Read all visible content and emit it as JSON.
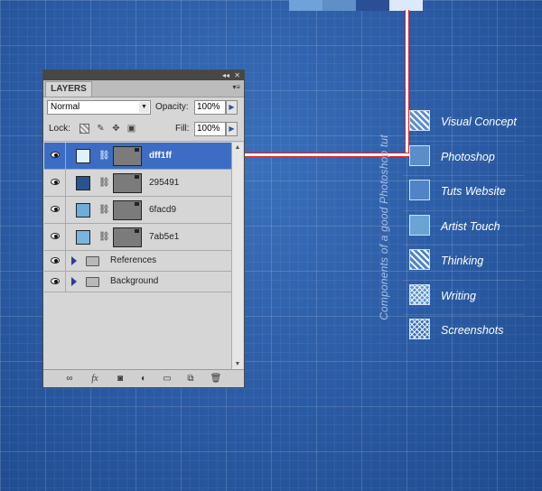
{
  "top_swatches": [
    "#6fa2d8",
    "#5e90c7",
    "#2a4f96",
    "#dbe9fb"
  ],
  "caption": "Components of a good Photoshop tut",
  "legend": [
    {
      "label": "Visual Concept",
      "style": "diag",
      "color": "#5c8dcb"
    },
    {
      "label": "Photoshop",
      "style": "solid",
      "color": "#5c8dcb"
    },
    {
      "label": "Tuts Website",
      "style": "solid",
      "color": "#4f84c6"
    },
    {
      "label": "Artist Touch",
      "style": "solid",
      "color": "#6aa4d6"
    },
    {
      "label": "Thinking",
      "style": "diag",
      "color": "#4f84c6"
    },
    {
      "label": "Writing",
      "style": "cross",
      "color": "#5c95d3"
    },
    {
      "label": "Screenshots",
      "style": "cross",
      "color": "#3f73bd"
    }
  ],
  "panel": {
    "tab": "LAYERS",
    "blend_mode": "Normal",
    "opacity_label": "Opacity:",
    "opacity": "100%",
    "lock_label": "Lock:",
    "fill_label": "Fill:",
    "fill": "100%",
    "layers": [
      {
        "name": "dff1ff",
        "color": "#dff1ff",
        "selected": true
      },
      {
        "name": "295491",
        "color": "#295491",
        "selected": false
      },
      {
        "name": "6facd9",
        "color": "#6facd9",
        "selected": false
      },
      {
        "name": "7ab5e1",
        "color": "#7ab5e1",
        "selected": false
      }
    ],
    "groups": [
      "References",
      "Background"
    ]
  }
}
